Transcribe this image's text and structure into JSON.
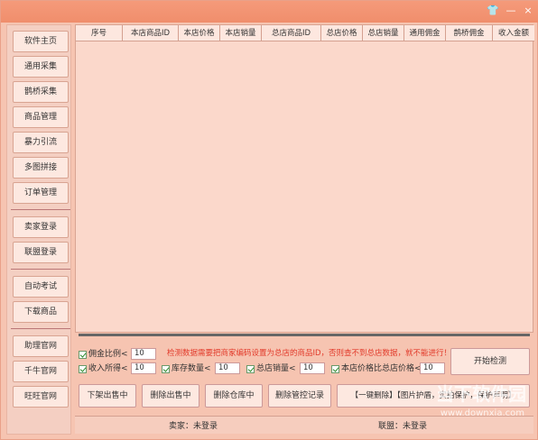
{
  "titlebar": {
    "icons": [
      "shirt-icon",
      "minimize-icon",
      "close-icon"
    ],
    "minimize": "—",
    "close": "×"
  },
  "sidebar": {
    "items": [
      "软件主页",
      "通用采集",
      "鹊桥采集",
      "商品管理",
      "暴力引流",
      "多图拼接",
      "订单管理",
      "卖家登录",
      "联盟登录",
      "自动考试",
      "下载商品",
      "助理官网",
      "千牛官网",
      "旺旺官网"
    ]
  },
  "table": {
    "columns": [
      "序号",
      "本店商品ID",
      "本店价格",
      "本店销量",
      "总店商品ID",
      "总店价格",
      "总店销量",
      "通用佣金",
      "鹊桥佣金",
      "收入金额"
    ]
  },
  "options": {
    "commission_label": "佣金比例<",
    "commission_value": "10",
    "notice": "检测数据需要把商家编码设置为总店的商品ID，否则查不到总店数据，就不能进行！",
    "income_label": "收入所得<",
    "income_value": "10",
    "stock_label": "库存数量<",
    "stock_value": "10",
    "total_sales_label": "总店销量<",
    "total_sales_value": "10",
    "price_ratio_label": "本店价格比总店价格<",
    "price_ratio_value": "10",
    "start_check": "开始检测"
  },
  "actions": {
    "offline_sold": "下架出售中",
    "delete_sold": "删除出售中",
    "delete_warehouse": "删除仓库中",
    "delete_control": "删除管控记录",
    "one_key_delete": "【一键删除】【图片护盾，实拍保护，保护声明】"
  },
  "status": {
    "seller": "卖家：未登录",
    "alliance": "联盟：未登录"
  },
  "watermark": {
    "brand": "当下软件园",
    "url": "www.downxia.com"
  }
}
